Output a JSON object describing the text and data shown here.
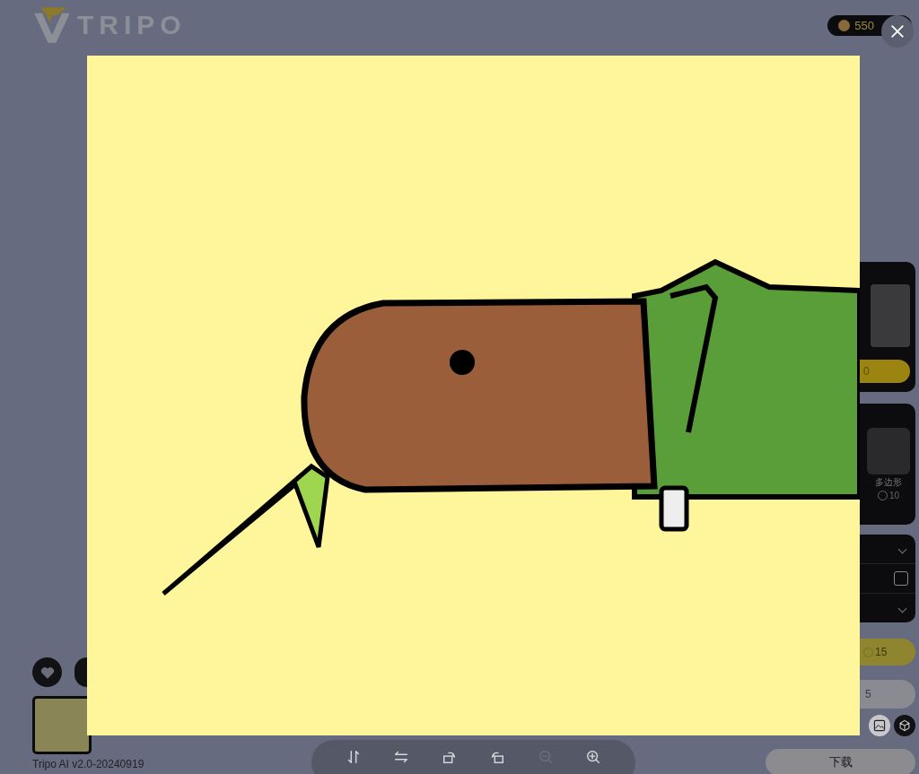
{
  "header": {
    "logo_text": "TRIPO",
    "credits": "550"
  },
  "right_panel": {
    "style_card": {
      "button": "0"
    },
    "mesh_card": {
      "option_label": "多边形",
      "cost": "10"
    },
    "settings_card": {
      "checked": false
    },
    "generate_button": "15",
    "secondary_button": "5",
    "view_modes": [
      {
        "kind": "image",
        "selected": true
      },
      {
        "kind": "model",
        "selected": false
      }
    ],
    "download_button": "下载"
  },
  "left": {
    "actions": [
      {
        "kind": "like"
      },
      {
        "kind": "share"
      }
    ],
    "version": "Tripo AI v2.0-20240919"
  },
  "preview": {
    "toolbar": [
      {
        "kind": "flip-vertical",
        "disabled": false
      },
      {
        "kind": "flip-horizontal",
        "disabled": false
      },
      {
        "kind": "rotate-right",
        "disabled": false
      },
      {
        "kind": "rotate-left",
        "disabled": false
      },
      {
        "kind": "zoom-out",
        "disabled": true
      },
      {
        "kind": "zoom-in",
        "disabled": false
      }
    ]
  }
}
